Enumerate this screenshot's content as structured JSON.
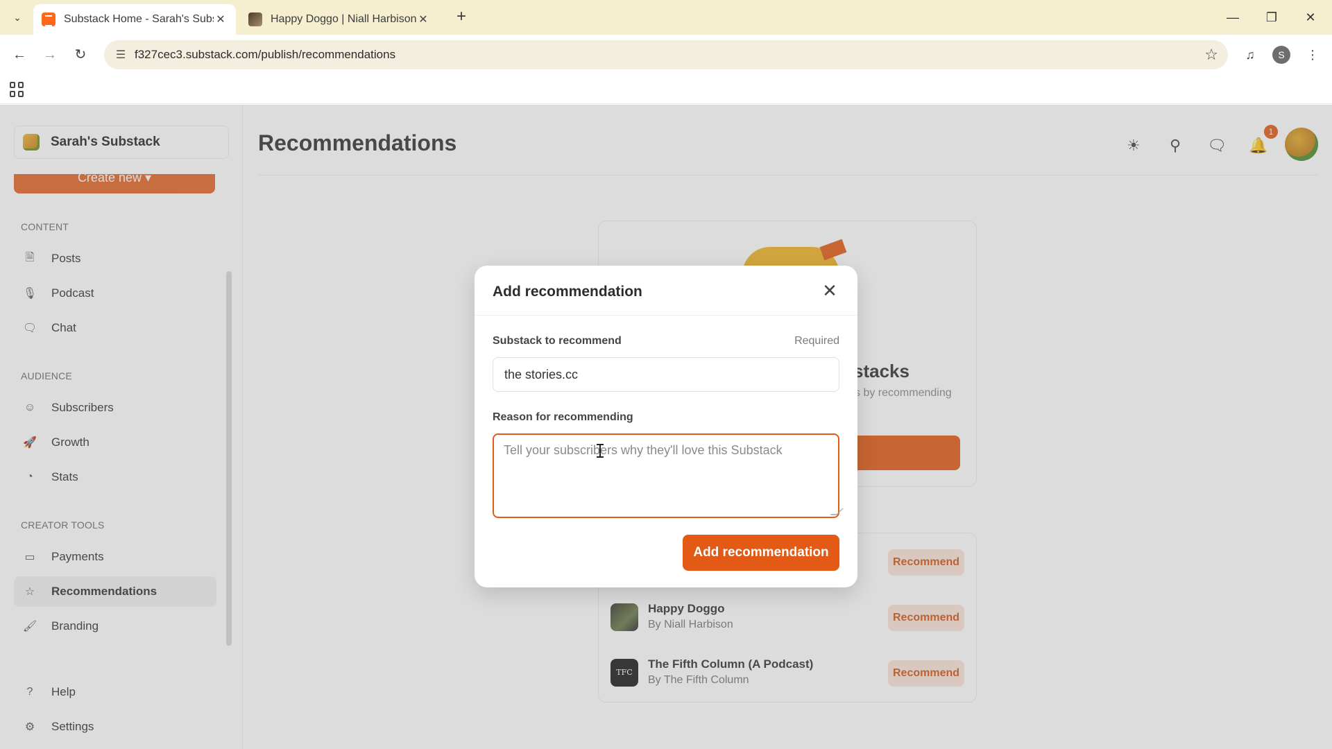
{
  "browser": {
    "tabs": [
      {
        "title": "Substack Home - Sarah's Substack",
        "active": true
      },
      {
        "title": "Happy Doggo | Niall Harbison | Substack",
        "active": false
      }
    ],
    "new_tab_symbol": "+",
    "url": "f327cec3.substack.com/publish/recommendations",
    "profile_initial": "S"
  },
  "sidebar": {
    "publication_name": "Sarah's Substack",
    "create_new_label": "Create new",
    "sections": {
      "content": "CONTENT",
      "audience": "AUDIENCE",
      "creator_tools": "CREATOR TOOLS"
    },
    "items": {
      "posts": "Posts",
      "podcast": "Podcast",
      "chat": "Chat",
      "subscribers": "Subscribers",
      "growth": "Growth",
      "stats": "Stats",
      "payments": "Payments",
      "recommendations": "Recommendations",
      "branding": "Branding",
      "help": "Help",
      "settings": "Settings"
    },
    "active_item": "recommendations"
  },
  "header": {
    "title": "Recommendations",
    "notification_count": "1"
  },
  "background": {
    "heading_fragment": "stacks",
    "sub_fragment": "s by recommending",
    "recommendations": [
      {
        "name": "Happy Doggo",
        "author": "By Niall Harbison",
        "button": "Recommend"
      },
      {
        "name": "The Fifth Column (A Podcast)",
        "author": "By The Fifth Column",
        "button": "Recommend"
      }
    ],
    "hidden_row_button": "Recommend",
    "tfc_thumb_text": "TFC"
  },
  "modal": {
    "title": "Add recommendation",
    "substack_label": "Substack to recommend",
    "required_label": "Required",
    "substack_value": "the stories.cc",
    "reason_label": "Reason for recommending",
    "reason_placeholder": "Tell your subscribers why they'll love this Substack",
    "reason_value": "",
    "submit_label": "Add recommendation"
  },
  "colors": {
    "accent": "#e25a16",
    "browser_chrome": "#f6efcf"
  }
}
